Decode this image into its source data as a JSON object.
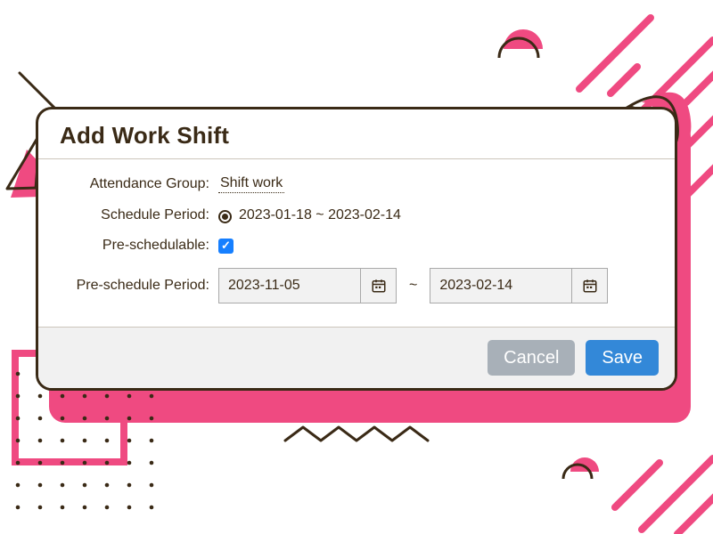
{
  "dialog": {
    "title": "Add Work Shift",
    "attendance_group_label": "Attendance Group:",
    "attendance_group_value": "Shift work",
    "schedule_period_label": "Schedule Period:",
    "schedule_period_value": "2023-01-18 ~ 2023-02-14",
    "preschedulable_label": "Pre-schedulable:",
    "preschedulable_checked": true,
    "preschedule_period_label": "Pre-schedule Period:",
    "preschedule_start": "2023-11-05",
    "preschedule_end": "2023-02-14",
    "separator": "~",
    "cancel_label": "Cancel",
    "save_label": "Save"
  }
}
